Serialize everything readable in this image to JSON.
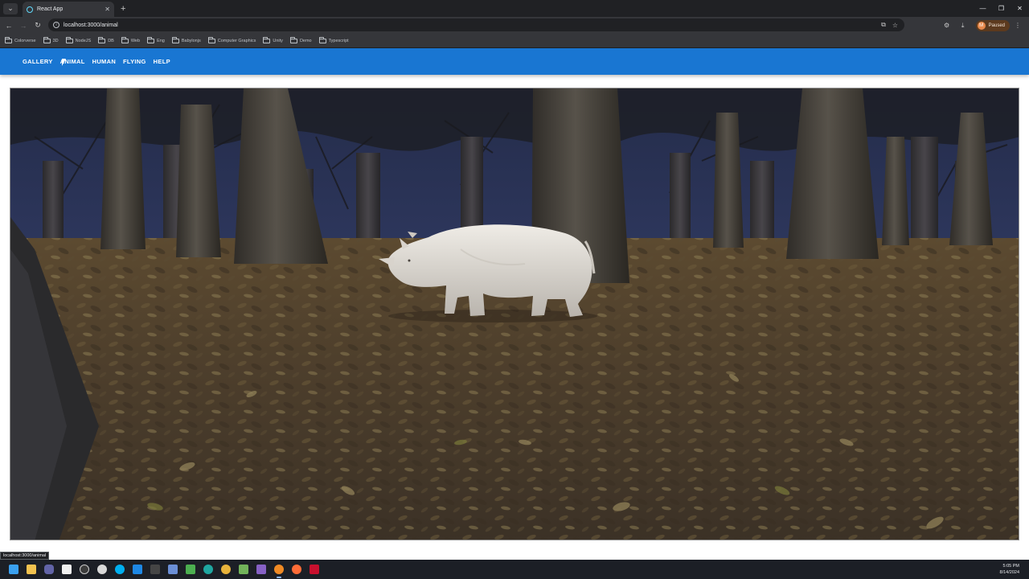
{
  "browser": {
    "tab_title": "React App",
    "tab_close": "✕",
    "new_tab": "+",
    "url": "localhost:3000/animal",
    "profile_initial": "M",
    "profile_label": "Paused",
    "bookmarks": [
      "Colorverse",
      "3D",
      "NodeJS",
      "DB",
      "Web",
      "Eng",
      "Babylonjs",
      "Computer Graphics",
      "Unity",
      "Demo",
      "Typescript"
    ]
  },
  "app": {
    "nav": [
      "GALLERY",
      "ANIMAL",
      "HUMAN",
      "FLYING",
      "HELP"
    ]
  },
  "status_url": "localhost:3000/animal",
  "clock": {
    "time": "5:05 PM",
    "date": "8/14/2024"
  },
  "colors": {
    "appbar": "#1976d2",
    "chrome_dark": "#202124",
    "chrome": "#35363a"
  },
  "taskbar_icons": [
    "windows-start",
    "file-explorer",
    "teams",
    "calendar",
    "obs",
    "chrome-dev",
    "skype",
    "vscode",
    "terminal",
    "save",
    "excel-style",
    "edge",
    "chrome",
    "notepad",
    "visual-studio",
    "chrome-active",
    "postman",
    "mcafee"
  ]
}
